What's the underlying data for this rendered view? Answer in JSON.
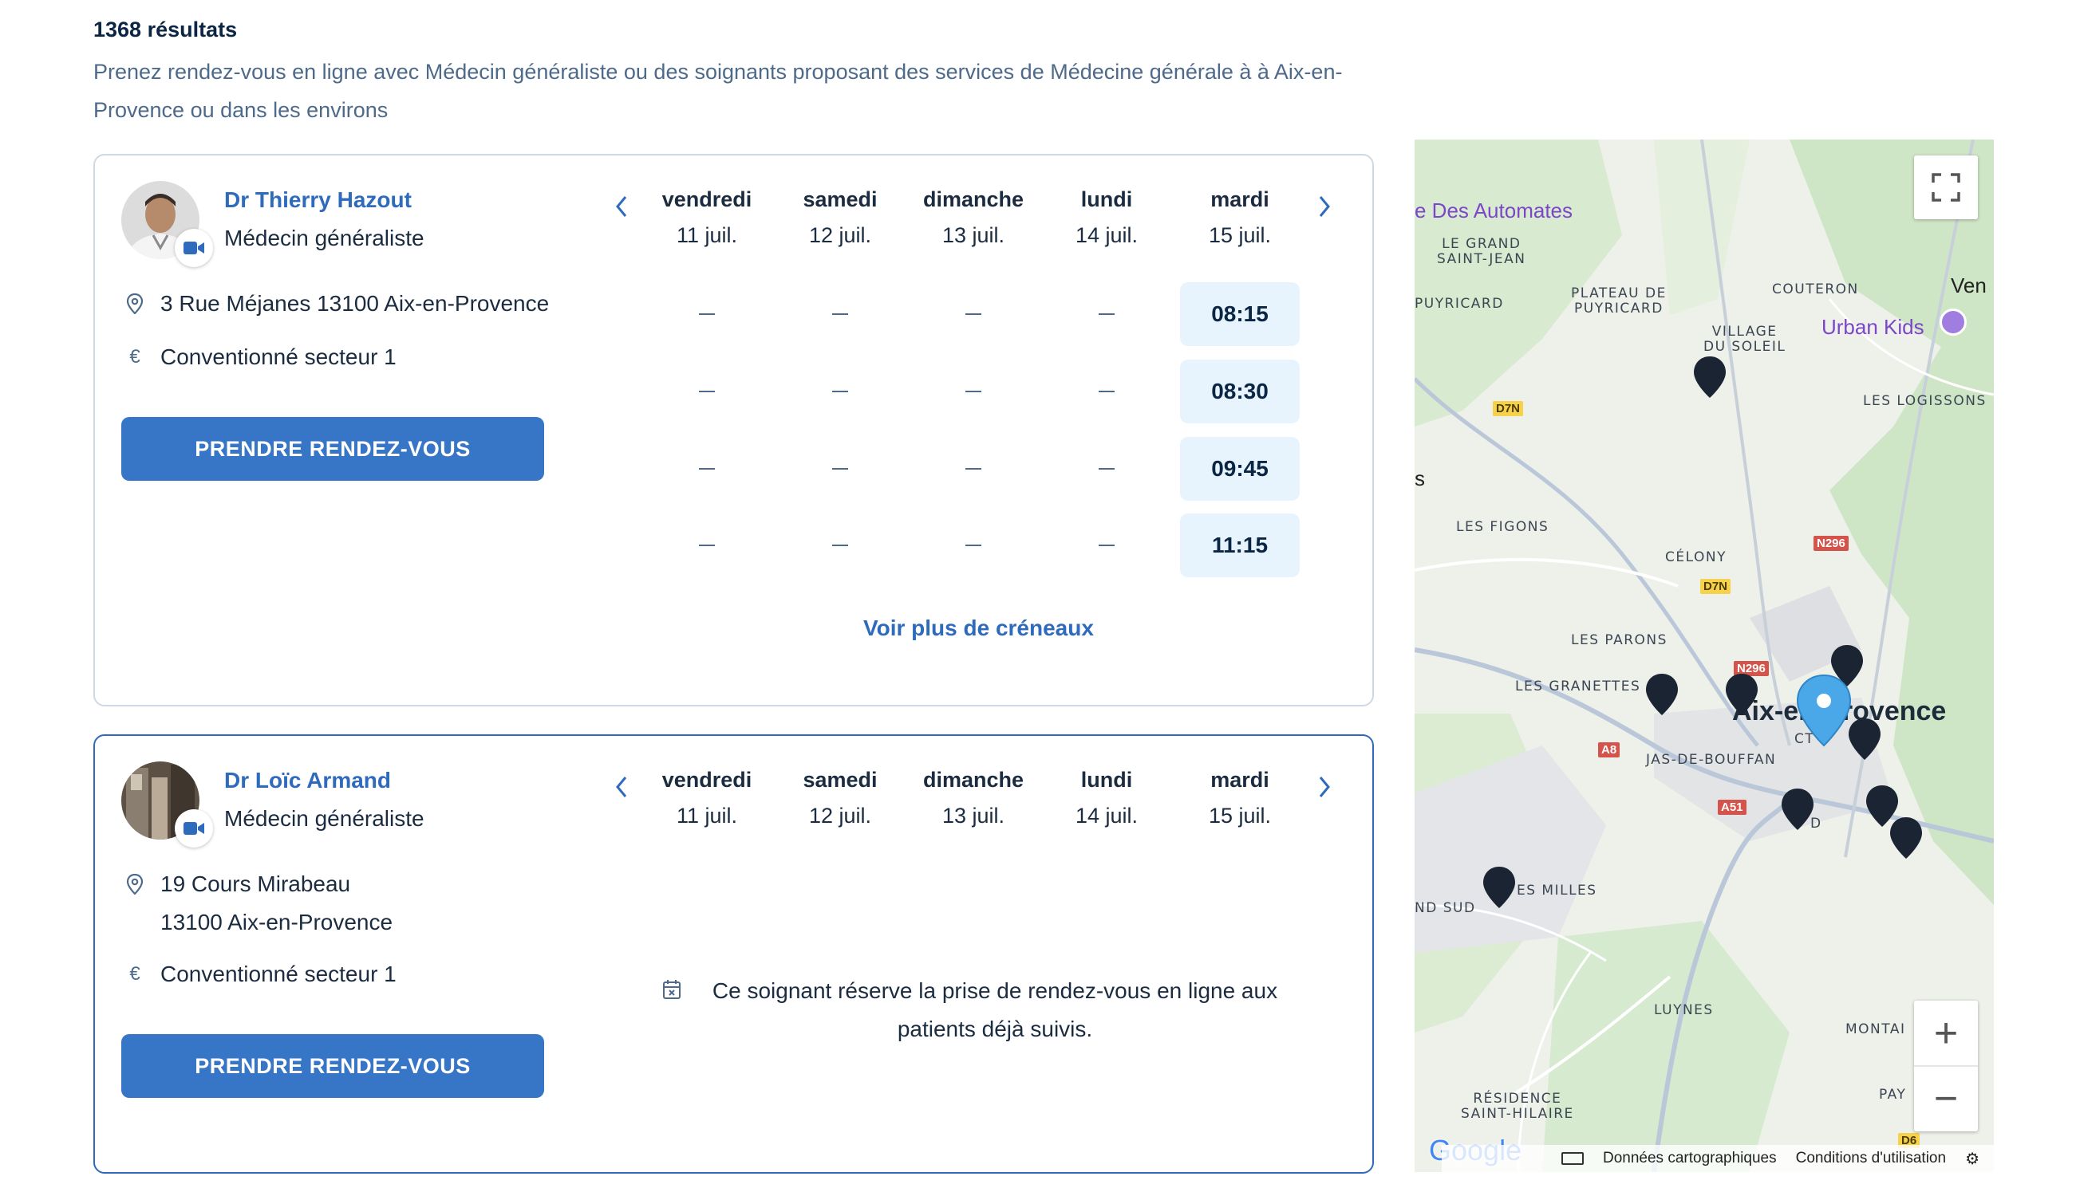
{
  "results": {
    "count": "1368 résultats",
    "intro": "Prenez rendez-vous en ligne avec Médecin généraliste ou des soignants proposant des services de Médecine générale à à Aix-en-Provence ou dans les environs"
  },
  "days": [
    {
      "name": "vendredi",
      "date": "11 juil."
    },
    {
      "name": "samedi",
      "date": "12 juil."
    },
    {
      "name": "dimanche",
      "date": "13 juil."
    },
    {
      "name": "lundi",
      "date": "14 juil."
    },
    {
      "name": "mardi",
      "date": "15 juil."
    }
  ],
  "doctors": [
    {
      "name": "Dr Thierry Hazout",
      "specialty": "Médecin généraliste",
      "address": "3 Rue Méjanes 13100 Aix-en-Provence",
      "convention": "Conventionné secteur 1",
      "book_label": "PRENDRE RENDEZ-VOUS",
      "slots": [
        "08:15",
        "08:30",
        "09:45",
        "11:15"
      ],
      "more_label": "Voir plus de créneaux"
    },
    {
      "name": "Dr Loïc Armand",
      "specialty": "Médecin généraliste",
      "address_line1": "19 Cours Mirabeau",
      "address_line2": "13100 Aix-en-Provence",
      "convention": "Conventionné secteur 1",
      "book_label": "PRENDRE RENDEZ-VOUS",
      "note": "Ce soignant réserve la prise de rendez-vous en ligne aux patients déjà suivis."
    }
  ],
  "map": {
    "labels": {
      "des_automates": "e Des Automates",
      "le_grand_saint_jean": "LE GRAND\nSAINT-JEAN",
      "plateau_de_puyricard": "PLATEAU DE\nPUYRICARD",
      "couteron": "COUTERON",
      "ven": "Ven",
      "puyricard": "PUYRICARD",
      "village_du_soleil": "VILLAGE\nDU SOLEIL",
      "urban_kids": "Urban Kids",
      "les_logissons": "LES LOGISSONS",
      "s": "s",
      "les_figons": "LES FIGONS",
      "celony": "CÉLONY",
      "les_parons": "LES PARONS",
      "les_granettes": "LES GRANETTES",
      "aix": "Aix-en-Provence",
      "ct": "CT",
      "jas_de_bouffan": "JAS-DE-BOUFFAN",
      "d": "D",
      "les_milles": "ES MILLES",
      "nd_sud": "ND SUD",
      "luynes": "LUYNES",
      "montai": "MONTAI",
      "residence": "RÉSIDENCE\nSAINT-HILAIRE",
      "pay": "PAY"
    },
    "roads": {
      "d7n_a": "D7N",
      "d7n_b": "D7N",
      "n296_a": "N296",
      "n296_b": "N296",
      "a8": "A8",
      "a51": "A51",
      "d6": "D6"
    },
    "google": "Google",
    "attribution_data": "Données cartographiques",
    "attribution_terms": "Conditions d'utilisation",
    "zoom_in": "+",
    "zoom_out": "−"
  }
}
